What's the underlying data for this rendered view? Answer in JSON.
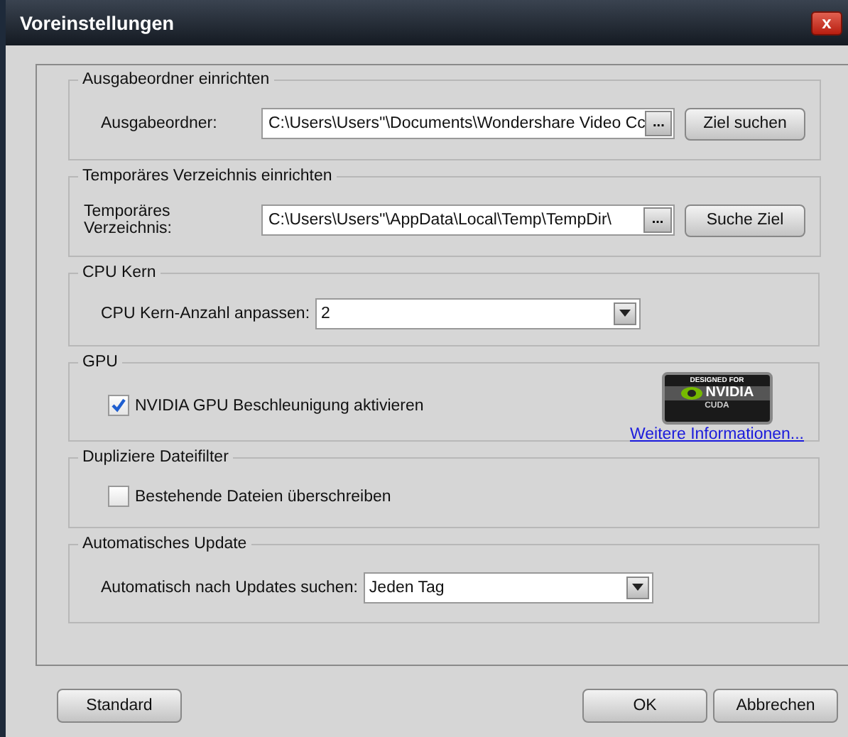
{
  "window": {
    "title": "Voreinstellungen",
    "close": "x"
  },
  "groups": [
    {
      "kind": "path",
      "title": "Ausgabeordner einrichten",
      "label": "Ausgabeordner:",
      "value": "C:\\Users\\Users''\\Documents\\Wondershare Video Cc",
      "browse": "...",
      "button": "Ziel suchen"
    },
    {
      "kind": "path",
      "title": "Temporäres Verzeichnis einrichten",
      "label": "Temporäres Verzeichnis:",
      "value": "C:\\Users\\Users''\\AppData\\Local\\Temp\\TempDir\\",
      "browse": "...",
      "button": "Suche Ziel"
    },
    {
      "kind": "select",
      "title": "CPU Kern",
      "label": "CPU Kern-Anzahl anpassen:",
      "value": "2"
    },
    {
      "kind": "checkbox",
      "title": "GPU",
      "label": "NVIDIA GPU Beschleunigung aktivieren",
      "checked": true,
      "badge": {
        "top": "DESIGNED FOR",
        "brand": "NVIDIA",
        "bottom": "CUDA"
      },
      "link": "Weitere Informationen..."
    },
    {
      "kind": "checkbox",
      "title": "Dupliziere Dateifilter",
      "label": "Bestehende Dateien überschreiben",
      "checked": false
    },
    {
      "kind": "select",
      "title": "Automatisches Update",
      "label": "Automatisch nach Updates suchen:",
      "value": "Jeden Tag"
    }
  ],
  "footer": {
    "left": "Standard",
    "ok": "OK",
    "cancel": "Abbrechen"
  }
}
